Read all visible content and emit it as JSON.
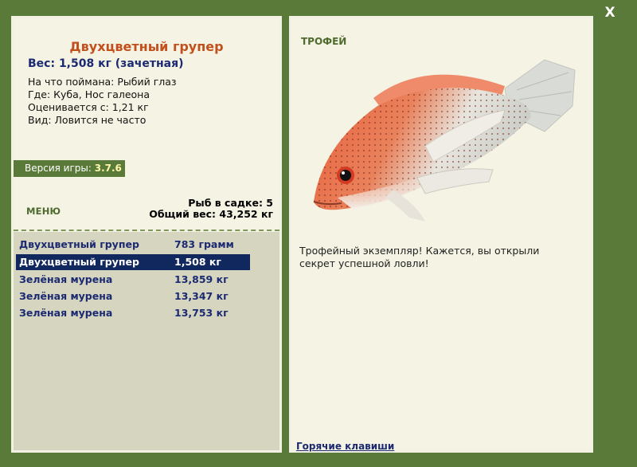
{
  "window": {
    "close_label": "X"
  },
  "fish": {
    "title": "Двухцветный групер",
    "weight_line": "Вес: 1,508 кг (зачетная)",
    "caught_on": "На что поймана: Рыбий глаз",
    "location": "Где: Куба, Нос галеона",
    "value": "Оценивается с: 1,21 кг",
    "frequency": "Вид: Ловится не часто"
  },
  "version": {
    "label": "Версия игры:",
    "value": "3.7.6"
  },
  "menu": {
    "label": "МЕНЮ"
  },
  "cage": {
    "count_line": "Рыб в садке: 5",
    "total_line": "Общий вес: 43,252 кг"
  },
  "catch_list": [
    {
      "name": "Двухцветный групер",
      "weight": "783 грамм",
      "selected": false
    },
    {
      "name": "Двухцветный групер",
      "weight": "1,508 кг",
      "selected": true
    },
    {
      "name": "Зелёная мурена",
      "weight": "13,859 кг",
      "selected": false
    },
    {
      "name": "Зелёная мурена",
      "weight": "13,347 кг",
      "selected": false
    },
    {
      "name": "Зелёная мурена",
      "weight": "13,753 кг",
      "selected": false
    }
  ],
  "trophy": {
    "label": "ТРОФЕЙ",
    "message": "Трофейный экземпляр! Кажется, вы открыли секрет успешной ловли!"
  },
  "hotkeys": {
    "label": "Горячие клавиши"
  },
  "colors": {
    "frame_green": "#5a7a3a",
    "panel_bg": "#f5f3e3",
    "list_bg": "#d6d5c0",
    "title_orange": "#c2501c",
    "navy": "#1c2a72",
    "selected_bg": "#11285e"
  }
}
